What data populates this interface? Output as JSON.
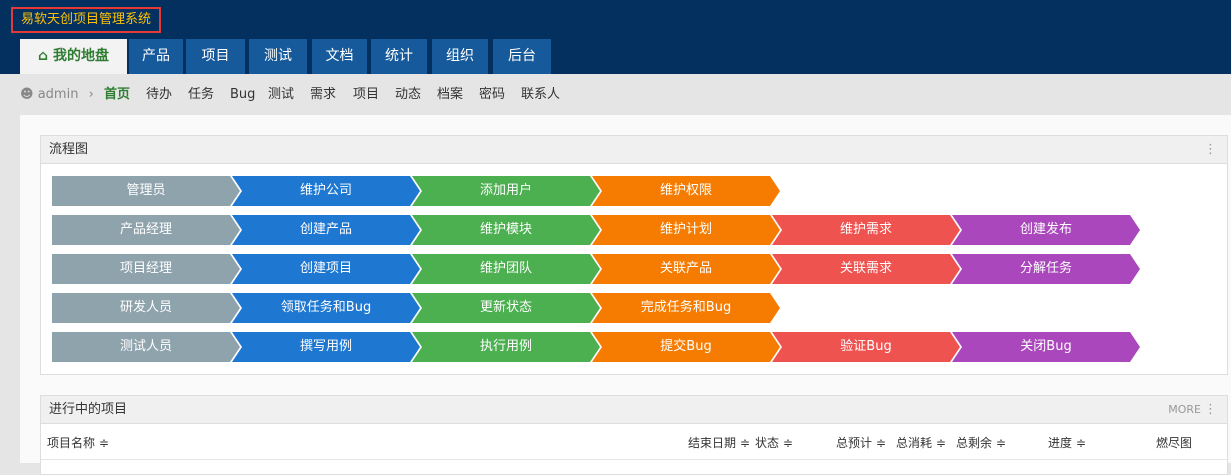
{
  "app_title": "易软天创项目管理系统",
  "nav": [
    "我的地盘",
    "产品",
    "项目",
    "测试",
    "文档",
    "统计",
    "组织",
    "后台"
  ],
  "user": "admin",
  "subnav": [
    "首页",
    "待办",
    "任务",
    "Bug",
    "测试",
    "需求",
    "项目",
    "动态",
    "档案",
    "密码",
    "联系人"
  ],
  "flow": {
    "title": "流程图",
    "rows": [
      [
        "管理员",
        "维护公司",
        "添加用户",
        "维护权限"
      ],
      [
        "产品经理",
        "创建产品",
        "维护模块",
        "维护计划",
        "维护需求",
        "创建发布"
      ],
      [
        "项目经理",
        "创建项目",
        "维护团队",
        "关联产品",
        "关联需求",
        "分解任务"
      ],
      [
        "研发人员",
        "领取任务和Bug",
        "更新状态",
        "完成任务和Bug"
      ],
      [
        "测试人员",
        "撰写用例",
        "执行用例",
        "提交Bug",
        "验证Bug",
        "关闭Bug"
      ]
    ]
  },
  "colors": [
    "#8fa3ad",
    "#1e78d2",
    "#4caf50",
    "#f57c00",
    "#ef5350",
    "#ab47bc"
  ],
  "projects": {
    "title": "进行中的项目",
    "more": "MORE",
    "columns": [
      "项目名称 ≑",
      "结束日期 ≑",
      "状态 ≑",
      "总预计 ≑",
      "总消耗 ≑",
      "总剩余 ≑",
      "进度 ≑",
      "燃尽图"
    ]
  }
}
